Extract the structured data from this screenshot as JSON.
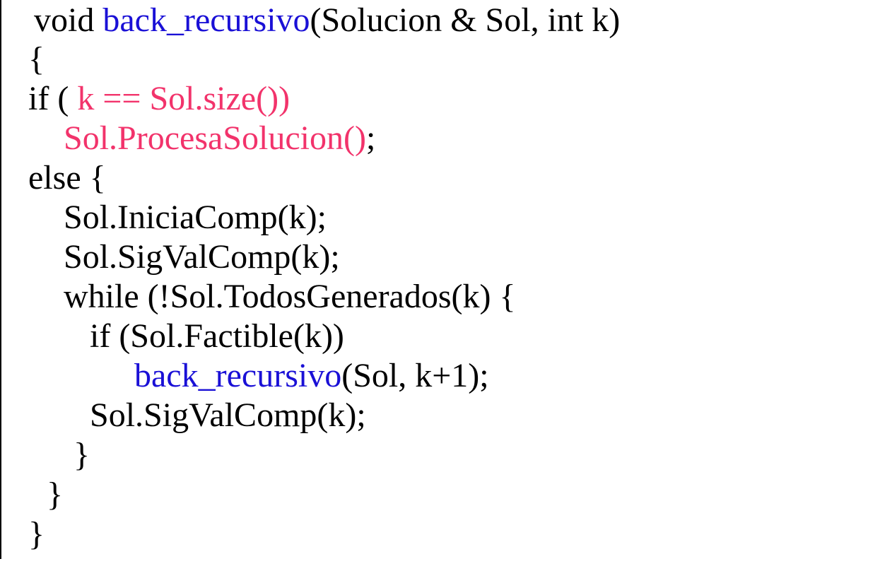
{
  "colors": {
    "text": "#000000",
    "function_name": "#1a10d6",
    "highlight": "#f2336b",
    "background": "#ffffff"
  },
  "code": {
    "line1": {
      "a": "void ",
      "fn": "back_recursivo",
      "b": "(Solucion & Sol, int k)"
    },
    "line2": "{",
    "line3": {
      "a": "if ( ",
      "hl": "k == Sol.size())"
    },
    "line4": {
      "hl": "Sol.ProcesaSolucion()",
      "b": ";"
    },
    "line5": "else {",
    "line6": "Sol.IniciaComp(k);",
    "line7": "Sol.SigValComp(k);",
    "line8": "while (!Sol.TodosGenerados(k) {",
    "line9": "if (Sol.Factible(k))",
    "line10": {
      "fn": "back_recursivo",
      "b": "(Sol, k+1);"
    },
    "line11": "Sol.SigValComp(k);",
    "line12": "}",
    "line13": "}",
    "line14": "}"
  }
}
